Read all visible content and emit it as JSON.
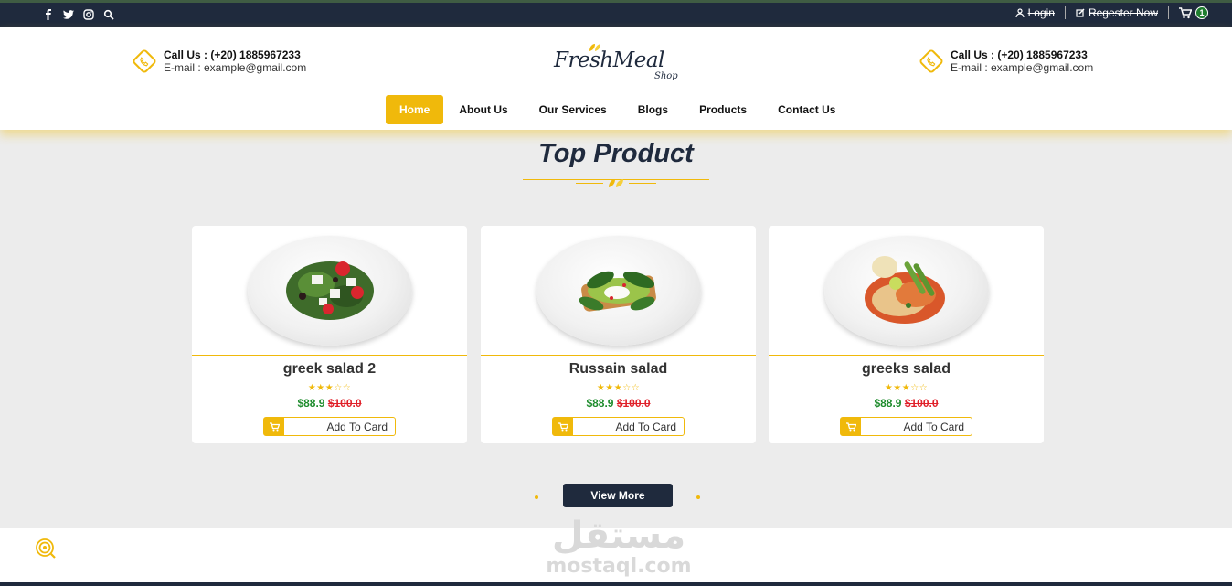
{
  "topbar": {
    "social": [
      {
        "icon": "facebook-icon",
        "glyph": "f"
      },
      {
        "icon": "twitter-icon",
        "glyph": "t"
      },
      {
        "icon": "instagram-icon",
        "glyph": "i"
      },
      {
        "icon": "search-icon",
        "glyph": "s"
      }
    ],
    "login_label": "Login",
    "register_label": "Regester Now",
    "cart_count": "1"
  },
  "header": {
    "contact_left": {
      "call": "Call Us : (+20) 1885967233",
      "email": "E-mail : example@gmail.com"
    },
    "contact_right": {
      "call": "Call Us : (+20) 1885967233",
      "email": "E-mail : example@gmail.com"
    },
    "logo": {
      "brand": "FreshMeal",
      "sub": "Shop"
    },
    "nav": [
      "Home",
      "About Us",
      "Our Services",
      "Blogs",
      "Products",
      "Contact Us"
    ],
    "active_nav": "Home"
  },
  "section": {
    "title": "Top Product"
  },
  "products": [
    {
      "name": "greek salad 2",
      "rating": 3,
      "max_rating": 5,
      "price": "$88.9",
      "old_price": "$100.0",
      "button": "Add To Card"
    },
    {
      "name": "Russain salad",
      "rating": 3,
      "max_rating": 5,
      "price": "$88.9",
      "old_price": "$100.0",
      "button": "Add To Card"
    },
    {
      "name": "greeks salad",
      "rating": 3,
      "max_rating": 5,
      "price": "$88.9",
      "old_price": "$100.0",
      "button": "Add To Card"
    }
  ],
  "view_more_label": "View More",
  "watermark": {
    "arabic": "مستقل",
    "latin": "mostaql.com"
  },
  "colors": {
    "accent": "#f0b90b",
    "dark": "#1f2a3d",
    "price": "#1e8c2d",
    "old_price": "#e0222b"
  }
}
